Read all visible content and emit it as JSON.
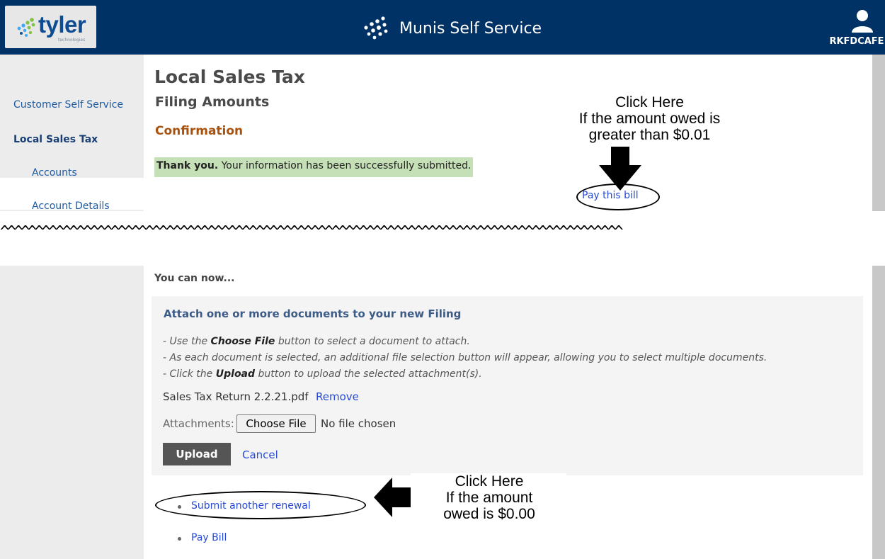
{
  "header": {
    "logo_text": "tyler",
    "logo_subtext": "technologies",
    "app_title": "Munis Self Service",
    "user_name": "RKFDCAFE",
    "background_color": "#003266"
  },
  "sidebar": {
    "items": [
      {
        "label": "Customer Self Service",
        "active": false
      },
      {
        "label": "Local Sales Tax",
        "active": true
      },
      {
        "label": "Accounts",
        "active": false
      },
      {
        "label": "Account Details",
        "active": false
      }
    ]
  },
  "main": {
    "page_title": "Local Sales Tax",
    "subtitle": "Filing Amounts",
    "section_title": "Confirmation",
    "success_bold": "Thank you.",
    "success_text": " Your information has been successfully submitted.",
    "pay_link": "Pay this bill"
  },
  "annotation_top": {
    "line1": "Click Here",
    "line2": "If the amount owed is",
    "line3": "greater than $0.01"
  },
  "divider_text": "^^^^^^^^^^^^^^^^^^^^^^^^^^^^^^^^^^^^^^^^^^^^^^^^^^^^^^^^^^^^^^^^^^^^^^^^^^^^^^^^^^^^^^^^^^",
  "next_steps": {
    "heading": "You can now...",
    "attach_title": "Attach one or more documents to your new Filing",
    "instr1_pre": "- Use the ",
    "instr1_bold": "Choose File",
    "instr1_post": " button to select a document to attach.",
    "instr2": "- As each document is selected, an additional file selection button will appear, allowing you to select multiple documents.",
    "instr3_pre": "- Click the ",
    "instr3_bold": "Upload",
    "instr3_post": " button to upload the selected attachment(s).",
    "file_name": "Sales Tax Return 2.2.21.pdf",
    "remove_label": "Remove",
    "attachments_label": "Attachments:",
    "choose_file_label": "Choose File",
    "no_file_text": "No file chosen",
    "upload_label": "Upload",
    "cancel_label": "Cancel",
    "links": [
      "Submit another renewal",
      "Pay Bill"
    ]
  },
  "annotation_bottom": {
    "line1": "Click Here",
    "line2": "If the amount",
    "line3": "owed is $0.00"
  },
  "colors": {
    "link": "#2649d6",
    "success_bg": "#c5dfb6",
    "confirmation": "#a9520e",
    "upload_button": "#555555"
  }
}
